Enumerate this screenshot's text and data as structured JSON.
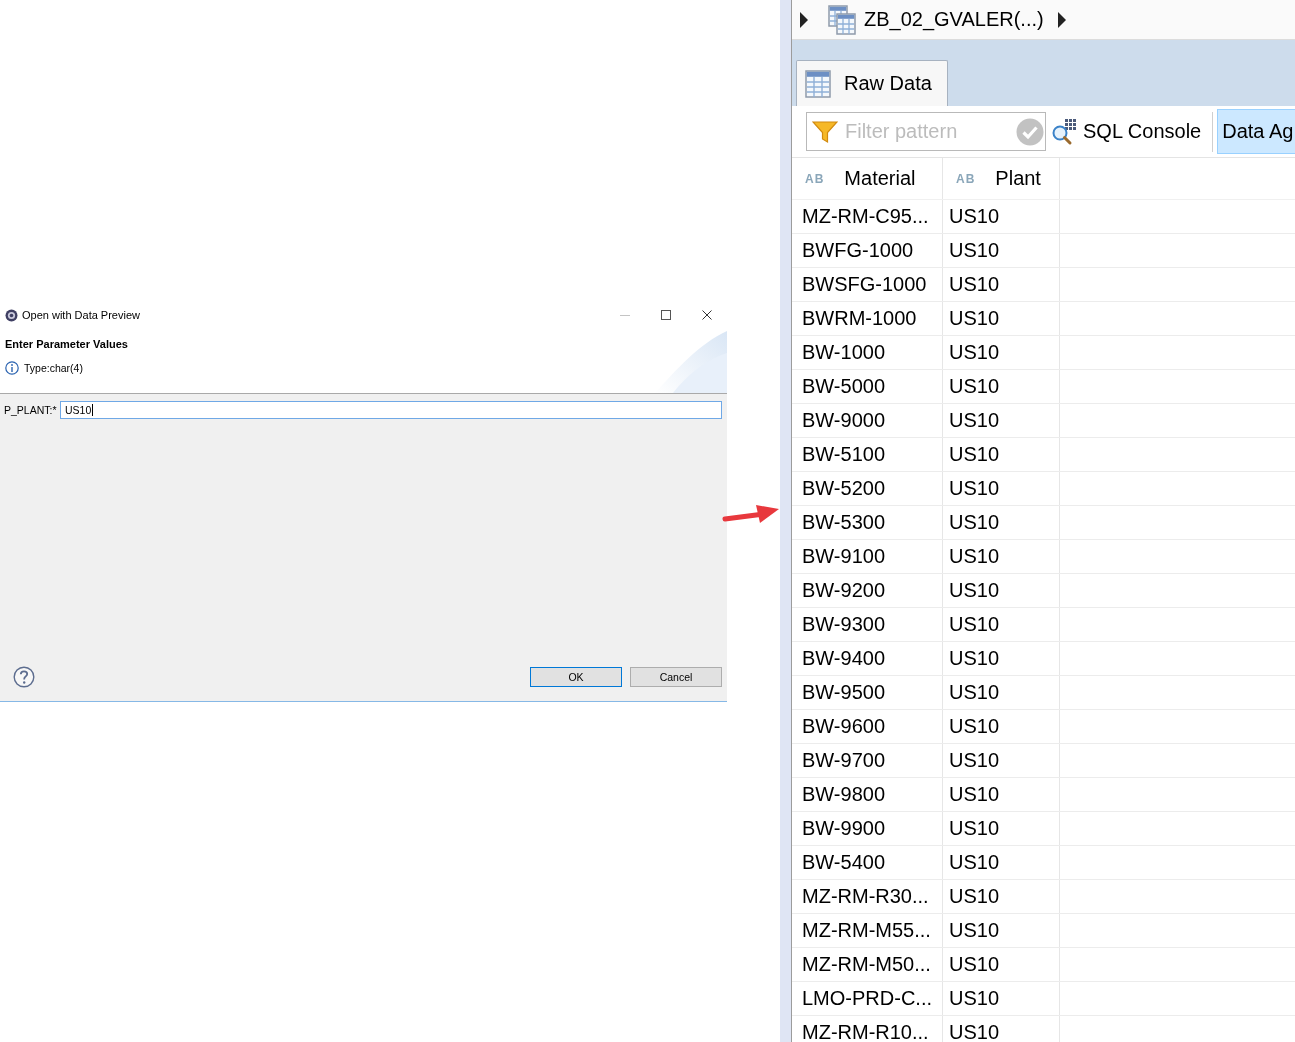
{
  "dialog": {
    "title": "Open with Data Preview",
    "heading": "Enter Parameter Values",
    "message": {
      "kind": "info",
      "text": "Type:char(4)"
    },
    "parameters": [
      {
        "label": "P_PLANT:*",
        "value": "US10",
        "focused": true
      }
    ],
    "buttons": [
      {
        "label": "OK",
        "default": true
      },
      {
        "label": "Cancel",
        "default": false
      }
    ]
  },
  "editor": {
    "breadcrumb": "ZB_02_GVALER(...)",
    "tabs": [
      {
        "label": "Raw Data",
        "selected": true
      }
    ],
    "filter": {
      "placeholder": "Filter pattern"
    },
    "toolbar_buttons": [
      {
        "label": "SQL Console",
        "kind": "console",
        "selected": false
      },
      {
        "label": "Data Ag",
        "kind": "plain",
        "selected": true
      }
    ],
    "table": {
      "columns": [
        {
          "type_label": "AB",
          "name": "Material"
        },
        {
          "type_label": "AB",
          "name": "Plant"
        }
      ],
      "rows": [
        [
          "MZ-RM-C95...",
          "US10"
        ],
        [
          "BWFG-1000",
          "US10"
        ],
        [
          "BWSFG-1000",
          "US10"
        ],
        [
          "BWRM-1000",
          "US10"
        ],
        [
          "BW-1000",
          "US10"
        ],
        [
          "BW-5000",
          "US10"
        ],
        [
          "BW-9000",
          "US10"
        ],
        [
          "BW-5100",
          "US10"
        ],
        [
          "BW-5200",
          "US10"
        ],
        [
          "BW-5300",
          "US10"
        ],
        [
          "BW-9100",
          "US10"
        ],
        [
          "BW-9200",
          "US10"
        ],
        [
          "BW-9300",
          "US10"
        ],
        [
          "BW-9400",
          "US10"
        ],
        [
          "BW-9500",
          "US10"
        ],
        [
          "BW-9600",
          "US10"
        ],
        [
          "BW-9700",
          "US10"
        ],
        [
          "BW-9800",
          "US10"
        ],
        [
          "BW-9900",
          "US10"
        ],
        [
          "BW-5400",
          "US10"
        ],
        [
          "MZ-RM-R30...",
          "US10"
        ],
        [
          "MZ-RM-M55...",
          "US10"
        ],
        [
          "MZ-RM-M50...",
          "US10"
        ],
        [
          "LMO-PRD-C...",
          "US10"
        ],
        [
          "MZ-RM-R10...",
          "US10"
        ]
      ]
    }
  }
}
